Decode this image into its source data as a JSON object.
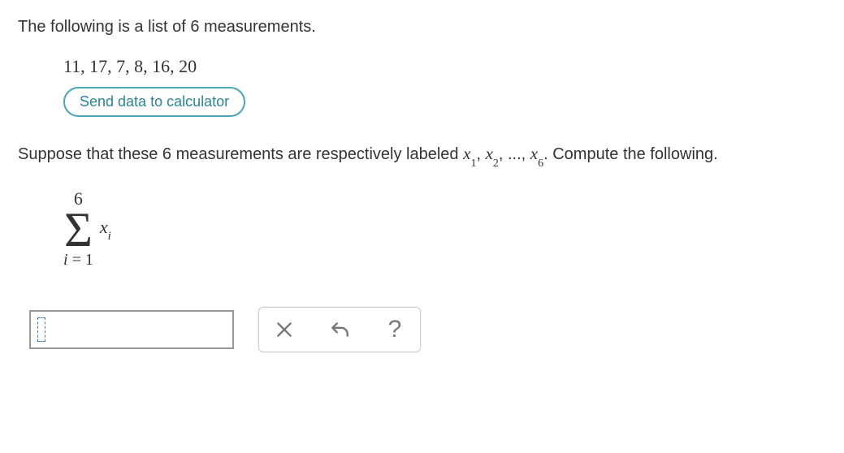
{
  "intro": "The following is a list of 6 measurements.",
  "data_values": "11, 17, 7, 8, 16, 20",
  "send_button_label": "Send data to calculator",
  "instruction_pre": "Suppose that these 6 measurements are respectively labeled ",
  "var_x": "x",
  "sub1": "1",
  "comma1": ", ",
  "sub2": "2",
  "comma2": ", ..., ",
  "sub6": "6",
  "instruction_post": ". Compute the following.",
  "sigma": {
    "upper": "6",
    "lower_var": "i",
    "lower_eq": " = 1",
    "term_var": "x",
    "term_sub": "i"
  },
  "actions": {
    "reset": "×",
    "undo": "↩",
    "help": "?"
  }
}
